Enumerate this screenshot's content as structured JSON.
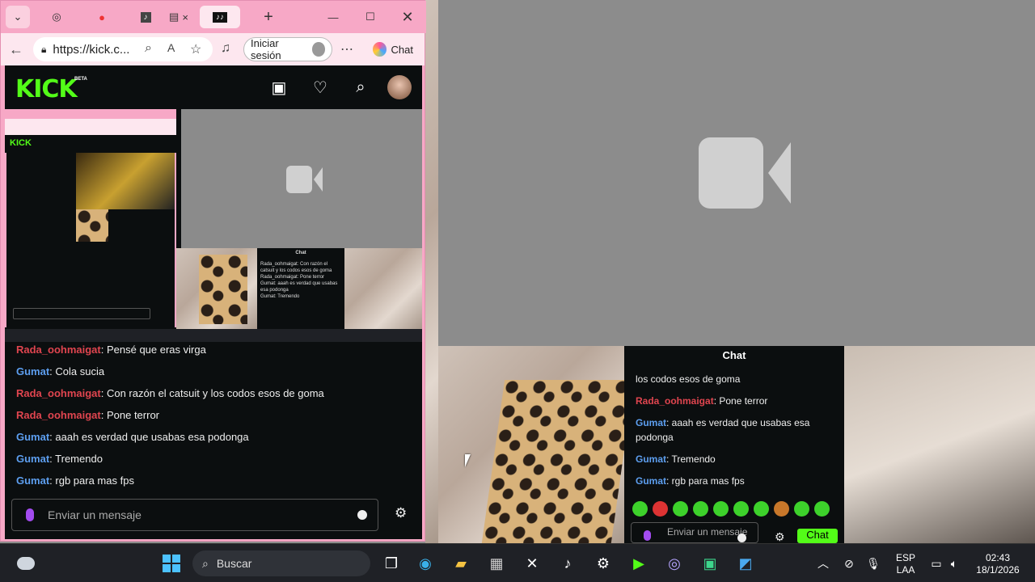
{
  "browser": {
    "url": "https://kick.c...",
    "login_label": "Iniciar sesión",
    "copilot_label": "Chat",
    "tabs": [
      "tab-1",
      "tab-2",
      "tab-3",
      "tab-4",
      "tab-5"
    ]
  },
  "kick": {
    "logo": "KICK",
    "beta": "BETA"
  },
  "left_chat": {
    "messages": [
      {
        "user": "Rada_oohmaigat",
        "text": ": Pensé que eras virga",
        "color": "red"
      },
      {
        "user": "Gumat",
        "text": ": Cola sucia",
        "color": "blue"
      },
      {
        "user": "Rada_oohmaigat",
        "text": ": Con razón el catsuit y los codos esos de goma",
        "color": "red"
      },
      {
        "user": "Rada_oohmaigat",
        "text": ": Pone terror",
        "color": "red"
      },
      {
        "user": "Gumat",
        "text": ": aaah es verdad que usabas esa podonga",
        "color": "blue"
      },
      {
        "user": "Gumat",
        "text": ": Tremendo",
        "color": "blue"
      },
      {
        "user": "Gumat",
        "text": ": rgb para mas fps",
        "color": "blue"
      }
    ],
    "input_placeholder": "Enviar un mensaje"
  },
  "right_chat": {
    "title": "Chat",
    "lines": [
      {
        "user": "",
        "text": "los codos esos de goma"
      },
      {
        "user": "Rada_oohmaigat",
        "text": ": Pone terror"
      },
      {
        "user": "Gumat",
        "text": ": aaah es verdad que usabas esa podonga"
      },
      {
        "user": "Gumat",
        "text": ": Tremendo"
      },
      {
        "user": "Gumat",
        "text": ": rgb para mas fps"
      }
    ],
    "input_placeholder": "Enviar un mensaje",
    "send_label": "Chat"
  },
  "mini_chat": {
    "title": "Chat",
    "lines": [
      "Rada_oohmaigat: Con razón el catsuit y los codos esos de goma",
      "Rada_oohmaigat: Pone terror",
      "Gumat: aaah es verdad que usabas esa podonga",
      "Gumat: Tremendo"
    ]
  },
  "taskbar": {
    "search_label": "Buscar",
    "lang_top": "ESP",
    "lang_bottom": "LAA",
    "time": "02:43",
    "date": "18/1/2026"
  }
}
